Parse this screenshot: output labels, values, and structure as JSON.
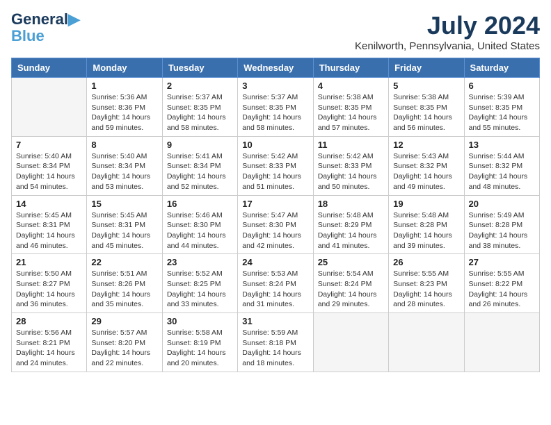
{
  "logo": {
    "line1": "General",
    "line2": "Blue"
  },
  "title": "July 2024",
  "location": "Kenilworth, Pennsylvania, United States",
  "headers": [
    "Sunday",
    "Monday",
    "Tuesday",
    "Wednesday",
    "Thursday",
    "Friday",
    "Saturday"
  ],
  "weeks": [
    [
      {
        "day": "",
        "info": ""
      },
      {
        "day": "1",
        "info": "Sunrise: 5:36 AM\nSunset: 8:36 PM\nDaylight: 14 hours\nand 59 minutes."
      },
      {
        "day": "2",
        "info": "Sunrise: 5:37 AM\nSunset: 8:35 PM\nDaylight: 14 hours\nand 58 minutes."
      },
      {
        "day": "3",
        "info": "Sunrise: 5:37 AM\nSunset: 8:35 PM\nDaylight: 14 hours\nand 58 minutes."
      },
      {
        "day": "4",
        "info": "Sunrise: 5:38 AM\nSunset: 8:35 PM\nDaylight: 14 hours\nand 57 minutes."
      },
      {
        "day": "5",
        "info": "Sunrise: 5:38 AM\nSunset: 8:35 PM\nDaylight: 14 hours\nand 56 minutes."
      },
      {
        "day": "6",
        "info": "Sunrise: 5:39 AM\nSunset: 8:35 PM\nDaylight: 14 hours\nand 55 minutes."
      }
    ],
    [
      {
        "day": "7",
        "info": "Sunrise: 5:40 AM\nSunset: 8:34 PM\nDaylight: 14 hours\nand 54 minutes."
      },
      {
        "day": "8",
        "info": "Sunrise: 5:40 AM\nSunset: 8:34 PM\nDaylight: 14 hours\nand 53 minutes."
      },
      {
        "day": "9",
        "info": "Sunrise: 5:41 AM\nSunset: 8:34 PM\nDaylight: 14 hours\nand 52 minutes."
      },
      {
        "day": "10",
        "info": "Sunrise: 5:42 AM\nSunset: 8:33 PM\nDaylight: 14 hours\nand 51 minutes."
      },
      {
        "day": "11",
        "info": "Sunrise: 5:42 AM\nSunset: 8:33 PM\nDaylight: 14 hours\nand 50 minutes."
      },
      {
        "day": "12",
        "info": "Sunrise: 5:43 AM\nSunset: 8:32 PM\nDaylight: 14 hours\nand 49 minutes."
      },
      {
        "day": "13",
        "info": "Sunrise: 5:44 AM\nSunset: 8:32 PM\nDaylight: 14 hours\nand 48 minutes."
      }
    ],
    [
      {
        "day": "14",
        "info": "Sunrise: 5:45 AM\nSunset: 8:31 PM\nDaylight: 14 hours\nand 46 minutes."
      },
      {
        "day": "15",
        "info": "Sunrise: 5:45 AM\nSunset: 8:31 PM\nDaylight: 14 hours\nand 45 minutes."
      },
      {
        "day": "16",
        "info": "Sunrise: 5:46 AM\nSunset: 8:30 PM\nDaylight: 14 hours\nand 44 minutes."
      },
      {
        "day": "17",
        "info": "Sunrise: 5:47 AM\nSunset: 8:30 PM\nDaylight: 14 hours\nand 42 minutes."
      },
      {
        "day": "18",
        "info": "Sunrise: 5:48 AM\nSunset: 8:29 PM\nDaylight: 14 hours\nand 41 minutes."
      },
      {
        "day": "19",
        "info": "Sunrise: 5:48 AM\nSunset: 8:28 PM\nDaylight: 14 hours\nand 39 minutes."
      },
      {
        "day": "20",
        "info": "Sunrise: 5:49 AM\nSunset: 8:28 PM\nDaylight: 14 hours\nand 38 minutes."
      }
    ],
    [
      {
        "day": "21",
        "info": "Sunrise: 5:50 AM\nSunset: 8:27 PM\nDaylight: 14 hours\nand 36 minutes."
      },
      {
        "day": "22",
        "info": "Sunrise: 5:51 AM\nSunset: 8:26 PM\nDaylight: 14 hours\nand 35 minutes."
      },
      {
        "day": "23",
        "info": "Sunrise: 5:52 AM\nSunset: 8:25 PM\nDaylight: 14 hours\nand 33 minutes."
      },
      {
        "day": "24",
        "info": "Sunrise: 5:53 AM\nSunset: 8:24 PM\nDaylight: 14 hours\nand 31 minutes."
      },
      {
        "day": "25",
        "info": "Sunrise: 5:54 AM\nSunset: 8:24 PM\nDaylight: 14 hours\nand 29 minutes."
      },
      {
        "day": "26",
        "info": "Sunrise: 5:55 AM\nSunset: 8:23 PM\nDaylight: 14 hours\nand 28 minutes."
      },
      {
        "day": "27",
        "info": "Sunrise: 5:55 AM\nSunset: 8:22 PM\nDaylight: 14 hours\nand 26 minutes."
      }
    ],
    [
      {
        "day": "28",
        "info": "Sunrise: 5:56 AM\nSunset: 8:21 PM\nDaylight: 14 hours\nand 24 minutes."
      },
      {
        "day": "29",
        "info": "Sunrise: 5:57 AM\nSunset: 8:20 PM\nDaylight: 14 hours\nand 22 minutes."
      },
      {
        "day": "30",
        "info": "Sunrise: 5:58 AM\nSunset: 8:19 PM\nDaylight: 14 hours\nand 20 minutes."
      },
      {
        "day": "31",
        "info": "Sunrise: 5:59 AM\nSunset: 8:18 PM\nDaylight: 14 hours\nand 18 minutes."
      },
      {
        "day": "",
        "info": ""
      },
      {
        "day": "",
        "info": ""
      },
      {
        "day": "",
        "info": ""
      }
    ]
  ]
}
